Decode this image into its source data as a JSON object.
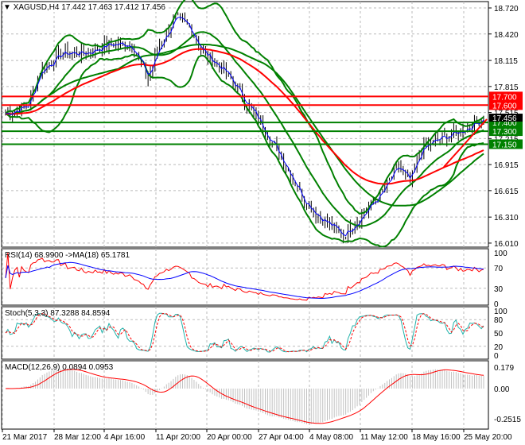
{
  "header": {
    "symbol": "XAGUSD,H4",
    "open": "17.442",
    "high": "17.463",
    "low": "17.412",
    "close": "17.456"
  },
  "price_axis": [
    "18.720",
    "18.420",
    "18.115",
    "17.815",
    "17.515",
    "17.215",
    "16.915",
    "16.615",
    "16.310",
    "16.010"
  ],
  "levels": [
    {
      "label": "17.700",
      "color": "#ff0000"
    },
    {
      "label": "17.600",
      "color": "#ff0000"
    },
    {
      "label": "17.400",
      "color": "#008000"
    },
    {
      "label": "17.300",
      "color": "#008000"
    },
    {
      "label": "17.150",
      "color": "#008000"
    }
  ],
  "current_price": "17.456",
  "rsi": {
    "label": "RSI(14) 68.9900  ->MA(18) 65.1781",
    "axis": [
      "100",
      "70",
      "30",
      "0"
    ]
  },
  "stoch": {
    "label": "Stoch(5,3,3) 87.3288 84.8594",
    "axis": [
      "100",
      "80",
      "50",
      "20",
      "0"
    ]
  },
  "macd": {
    "label": "MACD(12,26,9) 0.0894 0.0953",
    "axis": [
      "0.179",
      "0.00",
      "-0.2515"
    ]
  },
  "dates": [
    "21 Mar 2017",
    "28 Mar 12:00",
    "4 Apr 16:00",
    "11 Apr 20:00",
    "20 Apr 00:00",
    "27 Apr 04:00",
    "4 May 08:00",
    "11 May 12:00",
    "18 May 16:00",
    "25 May 20:00"
  ],
  "chart_data": {
    "type": "line",
    "title": "XAGUSD,H4",
    "ylim": [
      16.01,
      18.72
    ],
    "key_points": [
      [
        0,
        17.5
      ],
      [
        10,
        17.6
      ],
      [
        15,
        18.0
      ],
      [
        25,
        18.2
      ],
      [
        35,
        18.2
      ],
      [
        45,
        18.3
      ],
      [
        55,
        18.3
      ],
      [
        62,
        17.9
      ],
      [
        67,
        18.3
      ],
      [
        74,
        18.6
      ],
      [
        80,
        18.5
      ],
      [
        86,
        18.2
      ],
      [
        95,
        18.0
      ],
      [
        103,
        17.7
      ],
      [
        113,
        17.3
      ],
      [
        122,
        16.9
      ],
      [
        130,
        16.5
      ],
      [
        137,
        16.3
      ],
      [
        147,
        16.1
      ],
      [
        154,
        16.3
      ],
      [
        164,
        16.6
      ],
      [
        171,
        16.9
      ],
      [
        176,
        16.7
      ],
      [
        181,
        17.1
      ],
      [
        188,
        17.2
      ],
      [
        198,
        17.3
      ],
      [
        208,
        17.45
      ]
    ],
    "colors": {
      "candles": "#000000",
      "bollinger": "#008000",
      "ma_fast": "#0000ff",
      "ma_slow": "#ff0000",
      "rsi": "#ff0000",
      "rsi_ma": "#0000ff",
      "stoch_main": "#20b2aa",
      "stoch_signal": "#ff0000",
      "macd_hist": "#c0c0c0",
      "macd_signal": "#ff0000"
    }
  }
}
